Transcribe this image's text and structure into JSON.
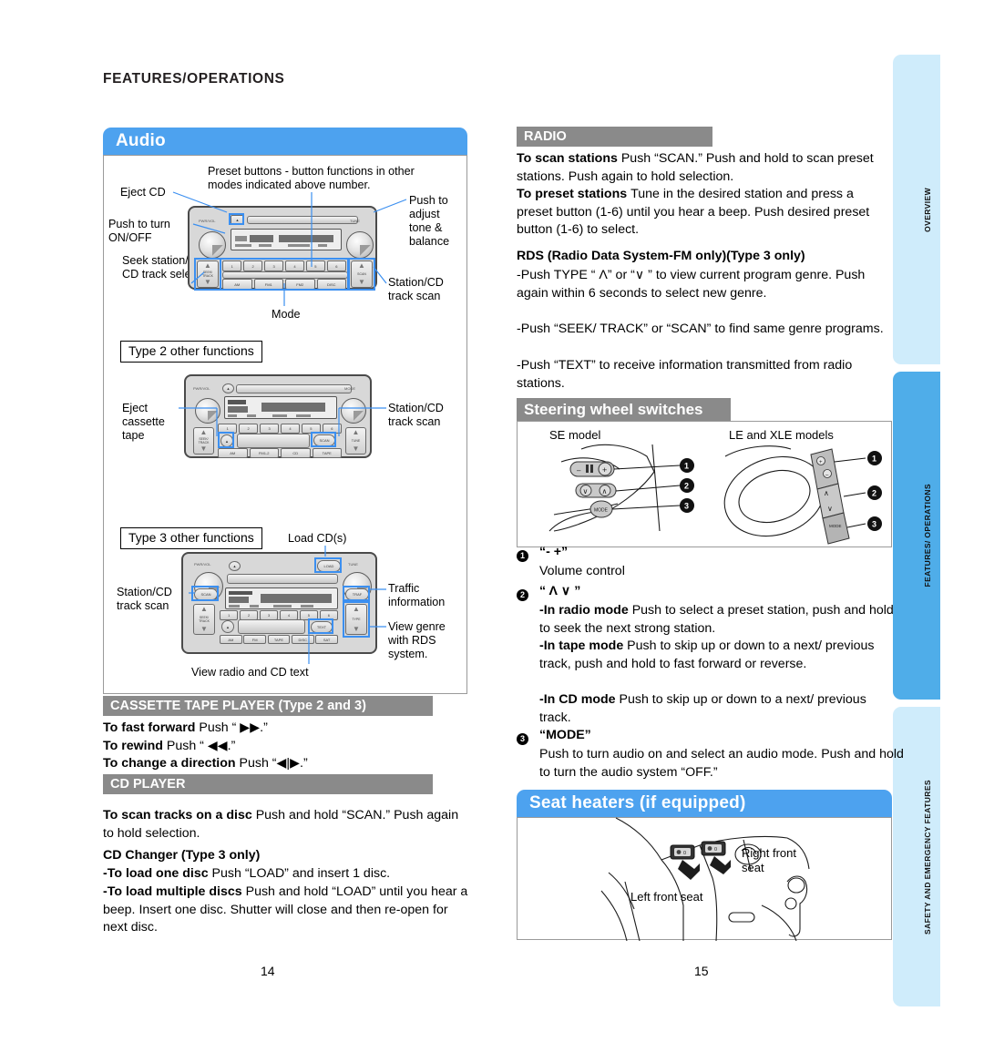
{
  "document": {
    "chapter_title": "FEATURES/OPERATIONS",
    "page_left_number": "14",
    "page_right_number": "15"
  },
  "side_tabs": [
    {
      "label": "OVERVIEW",
      "active": false,
      "color": "#cfecfb"
    },
    {
      "label": "FEATURES/ OPERATIONS",
      "active": true,
      "color": "#4fade9"
    },
    {
      "label": "SAFETY AND EMERGENCY FEATURES",
      "active": false,
      "color": "#cfecfb"
    }
  ],
  "colors": {
    "blue_bar": "#4da2ef",
    "grey_bar": "#8a8a8a",
    "highlight_blue": "#3b8ff0",
    "tab_pale": "#cfecfb",
    "tab_bright": "#4fade9"
  },
  "left_page": {
    "audio_section": {
      "title": "Audio",
      "type1_callouts": {
        "eject_cd": "Eject CD",
        "preset_buttons": "Preset buttons - button functions in other modes indicated above number.",
        "push_to_turn_on_off": "Push to turn ON/OFF",
        "push_to_adjust": "Push to adjust tone & balance",
        "seek_station": "Seek station/ CD track select",
        "station_cd_track_scan": "Station/CD track scan",
        "mode": "Mode"
      },
      "type2": {
        "heading": "Type 2 other functions",
        "eject_cassette_tape": "Eject cassette tape",
        "station_cd_track_scan": "Station/CD track scan"
      },
      "type3": {
        "heading": "Type 3 other functions",
        "load_cds": "Load CD(s)",
        "station_cd_track_scan": "Station/CD track scan",
        "traffic_information": "Traffic information",
        "view_genre": "View genre with RDS system.",
        "view_radio_cd_text": "View radio and CD text"
      },
      "head_unit_buttons": {
        "presets": [
          "1",
          "2",
          "3",
          "4",
          "5",
          "6"
        ],
        "type1_modes": [
          "AM",
          "FM1",
          "FM2",
          "DISC"
        ],
        "type2_modes": [
          "AM",
          "FM1-2",
          "CD",
          "TAPE"
        ],
        "type3_modes": [
          "AM",
          "FM",
          "TAPE",
          "DISC",
          "SAT"
        ],
        "left_knob_type1": "PWR/VOL",
        "right_knob_type1": "TUNE",
        "left_rocker": "SEEK/ TRACK",
        "right_rocker_type1": "SCAN",
        "right_rocker_type2": "TUNE",
        "right_rocker_type3": "TYPE",
        "load": "LOAD",
        "scan": "SCAN",
        "text": "TEXT",
        "traffic": "TRAF",
        "mode": "MODE"
      }
    },
    "cassette_section": {
      "title": "CASSETTE TAPE PLAYER (Type 2 and 3)",
      "lines": [
        {
          "bold": "To fast forward ",
          "rest": "Push “ ▶▶.”"
        },
        {
          "bold": "To rewind ",
          "rest": "Push “ ◀◀.”"
        },
        {
          "bold": "To change a direction ",
          "rest": "Push “◀|▶.”"
        }
      ]
    },
    "cd_section": {
      "title": "CD PLAYER",
      "scan_bold": "To scan tracks on a disc ",
      "scan_rest": "Push and hold “SCAN.” Push again to hold selection.",
      "changer_heading": "CD Changer (Type 3 only)",
      "load_one_bold": "-To load one disc ",
      "load_one_rest": "Push “LOAD” and insert 1 disc.",
      "load_multi_bold": "-To load multiple discs ",
      "load_multi_rest": "Push and hold “LOAD” until you hear a beep. Insert one disc. Shutter will close and then re-open for next disc."
    }
  },
  "right_page": {
    "radio_section": {
      "title": "RADIO",
      "scan_bold": "To scan stations ",
      "scan_rest": "Push “SCAN.” Push and hold to scan preset stations. Push again to hold selection.",
      "preset_bold": "To preset stations ",
      "preset_rest": "Tune in the desired station and press a preset button (1-6) until you hear a beep. Push desired preset button (1-6) to select.",
      "rds_heading": "RDS (Radio Data System-FM only)(Type 3 only)",
      "rds_lines": [
        "-Push TYPE “ Λ” or “∨ ” to view current program genre. Push again within 6 seconds to select new genre.",
        "-Push “SEEK/ TRACK” or “SCAN” to find same genre programs.",
        "-Push “TEXT” to receive information transmitted from radio stations."
      ]
    },
    "steering_section": {
      "title": "Steering wheel switches",
      "se_model_label": "SE model",
      "le_xle_label": "LE and XLE models",
      "callout_numbers": [
        "1",
        "2",
        "3"
      ],
      "legend": [
        {
          "num": "1",
          "symbol": "“- +”",
          "lines": [
            {
              "bold": "",
              "rest": "Volume control"
            }
          ]
        },
        {
          "num": "2",
          "symbol": "“ Λ ∨ ”",
          "lines": [
            {
              "bold": "-In radio mode ",
              "rest": "Push to select a preset station, push and hold to seek the next strong station."
            },
            {
              "bold": "-In tape mode ",
              "rest": "Push to skip up or down to a next/ previous track, push and hold to fast forward or reverse."
            },
            {
              "bold": "-In CD mode ",
              "rest": "Push to skip up or down to a next/ previous track."
            }
          ]
        },
        {
          "num": "3",
          "symbol": "“MODE”",
          "lines": [
            {
              "bold": "",
              "rest": "Push to turn audio on and select an audio mode. Push and hold to turn the audio system “OFF.”"
            }
          ]
        }
      ],
      "wheel_button_labels": {
        "mode": "MODE",
        "volume_minus": "–",
        "volume_plus": "+"
      }
    },
    "seat_heaters_section": {
      "title": "Seat heaters (if equipped)",
      "left_front_seat": "Left front seat",
      "right_front_seat": "Right front seat"
    }
  }
}
